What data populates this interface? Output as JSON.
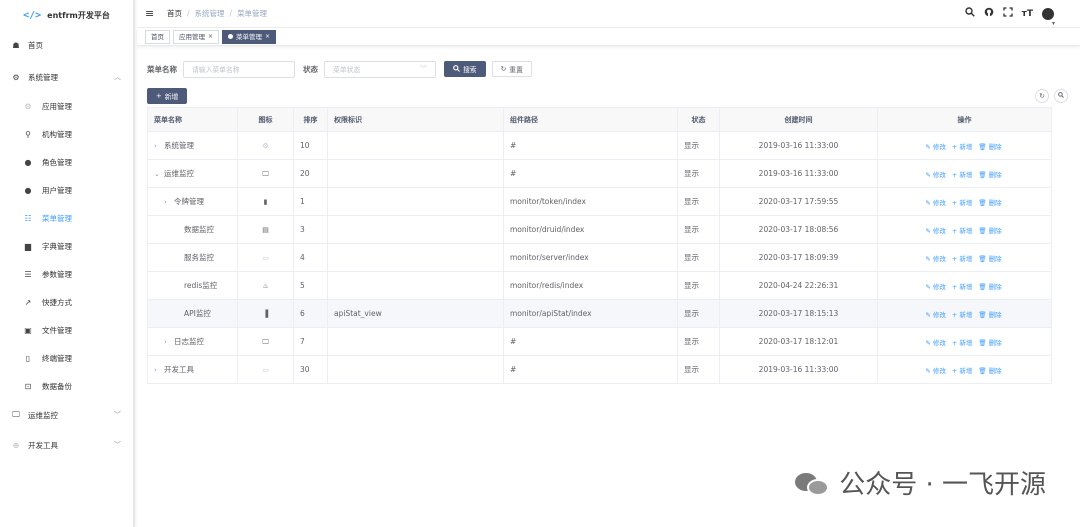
{
  "app": {
    "logo_mark": "</>",
    "title": "entfrm开发平台"
  },
  "sidebar": {
    "items": [
      {
        "label": "首页",
        "icon": "dashboard-icon"
      },
      {
        "label": "系统管理",
        "icon": "gear-icon",
        "caret": "^"
      },
      {
        "label": "应用管理",
        "icon": "app-icon"
      },
      {
        "label": "机构管理",
        "icon": "org-tree-icon"
      },
      {
        "label": "角色管理",
        "icon": "role-icon"
      },
      {
        "label": "用户管理",
        "icon": "user-icon"
      },
      {
        "label": "菜单管理",
        "icon": "tree-table-icon"
      },
      {
        "label": "字典管理",
        "icon": "dict-icon"
      },
      {
        "label": "参数管理",
        "icon": "list-icon"
      },
      {
        "label": "快捷方式",
        "icon": "shortcut-icon"
      },
      {
        "label": "文件管理",
        "icon": "file-icon"
      },
      {
        "label": "终端管理",
        "icon": "phone-icon"
      },
      {
        "label": "数据备份",
        "icon": "chart-icon"
      },
      {
        "label": "运维监控",
        "icon": "monitor-icon",
        "caret": "v"
      },
      {
        "label": "开发工具",
        "icon": "tool-icon",
        "caret": "v"
      }
    ]
  },
  "header": {
    "menu_icon": "≡",
    "breadcrumb": [
      "首页",
      "系统管理",
      "菜单管理"
    ],
    "sep": "/",
    "font_size_icon": "тT"
  },
  "tags": {
    "items": [
      {
        "label": "首页",
        "closable": false
      },
      {
        "label": "应用管理",
        "closable": true
      },
      {
        "label": "菜单管理",
        "closable": true,
        "active": true
      }
    ],
    "close": "×"
  },
  "search": {
    "name_label": "菜单名称",
    "name_placeholder": "请输入菜单名称",
    "status_label": "状态",
    "status_placeholder": "菜单状态",
    "search_button": "搜索",
    "reset_button": "重置"
  },
  "toolbar": {
    "add_button": "新增"
  },
  "table": {
    "headers": [
      "菜单名称",
      "图标",
      "排序",
      "权限标识",
      "组件路径",
      "状态",
      "创建时间",
      "操作"
    ],
    "rows": [
      {
        "name": "系统管理",
        "expander": "›",
        "indent": 0,
        "icon": "⚙",
        "order": "10",
        "perm": "",
        "path": "#",
        "status": "显示",
        "created": "2019-03-16 11:33:00"
      },
      {
        "name": "运维监控",
        "expander": "⌄",
        "indent": 0,
        "icon": "🖵",
        "order": "20",
        "perm": "",
        "path": "#",
        "status": "显示",
        "created": "2019-03-16 11:33:00"
      },
      {
        "name": "令牌管理",
        "expander": "›",
        "indent": 1,
        "icon": "▮",
        "order": "1",
        "perm": "",
        "path": "monitor/token/index",
        "status": "显示",
        "created": "2020-03-17 17:59:55"
      },
      {
        "name": "数据监控",
        "expander": "",
        "indent": 2,
        "icon": "▤",
        "order": "3",
        "perm": "",
        "path": "monitor/druid/index",
        "status": "显示",
        "created": "2020-03-17 18:08:56"
      },
      {
        "name": "服务监控",
        "expander": "",
        "indent": 2,
        "icon": "▭",
        "order": "4",
        "perm": "",
        "path": "monitor/server/index",
        "status": "显示",
        "created": "2020-03-17 18:09:39"
      },
      {
        "name": "redis监控",
        "expander": "",
        "indent": 2,
        "icon": "♨",
        "order": "5",
        "perm": "",
        "path": "monitor/redis/index",
        "status": "显示",
        "created": "2020-04-24 22:26:31"
      },
      {
        "name": "API监控",
        "expander": "",
        "indent": 2,
        "icon": "▐",
        "order": "6",
        "perm": "apiStat_view",
        "path": "monitor/apiStat/index",
        "status": "显示",
        "created": "2020-03-17 18:15:13"
      },
      {
        "name": "日志监控",
        "expander": "›",
        "indent": 1,
        "icon": "🖵",
        "order": "7",
        "perm": "",
        "path": "#",
        "status": "显示",
        "created": "2020-03-17 18:12:01"
      },
      {
        "name": "开发工具",
        "expander": "›",
        "indent": 0,
        "icon": "▭",
        "order": "30",
        "perm": "",
        "path": "#",
        "status": "显示",
        "created": "2019-03-16 11:33:00"
      }
    ],
    "ops": {
      "edit": "修改",
      "add": "新增",
      "delete": "删除"
    }
  },
  "watermark": {
    "text": "公众号 · 一飞开源"
  }
}
